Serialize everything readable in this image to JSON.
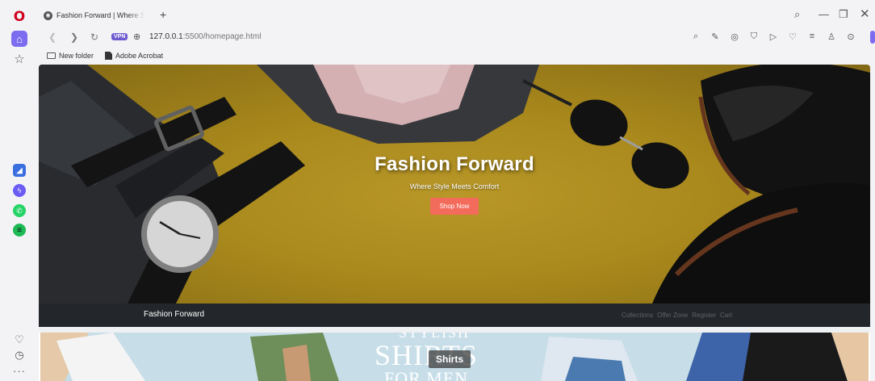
{
  "browser": {
    "tab_title": "Fashion Forward | Where S",
    "new_tab_symbol": "+",
    "url_host": "127.0.0.1",
    "url_rest": ":5500/homepage.html",
    "vpn_label": "VPN",
    "bookmarks": [
      "New folder",
      "Adobe Acrobat"
    ],
    "icons": {
      "sidebar": [
        "opera-logo-icon",
        "home-icon",
        "star-icon",
        "ai-app-icon",
        "messenger-icon",
        "whatsapp-icon",
        "spotify-icon",
        "heart-icon",
        "clock-icon",
        "more-icon"
      ],
      "toolbar": [
        "search-icon",
        "edit-icon",
        "camera-icon",
        "shield-icon",
        "send-icon",
        "heart-icon",
        "menu-icon",
        "account-icon",
        "box-icon"
      ]
    },
    "accent_color": "#7c6cf0"
  },
  "hero": {
    "title": "Fashion Forward",
    "subtitle": "Where Style Meets Comfort",
    "cta_label": "Shop Now",
    "cta_color": "#f26b5b"
  },
  "site_nav": {
    "brand": "Fashion Forward",
    "links": [
      "Collections",
      "Offer Zone",
      "Register",
      "Cart"
    ]
  },
  "category_banner": {
    "label": "Shirts",
    "text_top": "STYLISH",
    "text_big": "SHIRTS",
    "text_small": "FOR MEN"
  }
}
